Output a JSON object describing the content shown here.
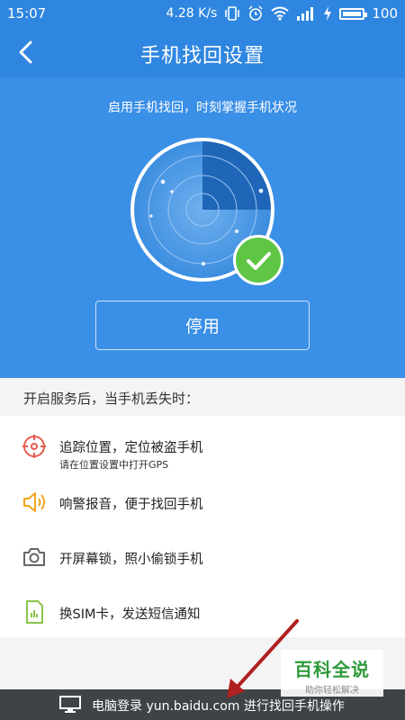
{
  "status_bar": {
    "time": "15:07",
    "speed": "4.28 K/s",
    "battery": "100"
  },
  "header": {
    "title": "手机找回设置"
  },
  "hero": {
    "subtitle": "启用手机找回，时刻掌握手机状况",
    "button_label": "停用",
    "colors": {
      "primary": "#2f86e0",
      "hero_bg": "#3a8fe6",
      "check_green": "#5fc645"
    }
  },
  "features": {
    "header": "开启服务后，当手机丢失时：",
    "items": [
      {
        "icon": "target-icon",
        "label": "追踪位置，定位被盗手机",
        "sublabel": "请在位置设置中打开GPS",
        "color": "#e55b4c"
      },
      {
        "icon": "speaker-icon",
        "label": "响警报音，便于找回手机",
        "color": "#f2a51c"
      },
      {
        "icon": "camera-icon",
        "label": "开屏幕锁，照小偷锁手机",
        "color": "#666666"
      },
      {
        "icon": "sim-card-icon",
        "label": "换SIM卡，发送短信通知",
        "color": "#8bc34a"
      }
    ]
  },
  "bottom": {
    "text": "电脑登录 yun.baidu.com 进行找回手机操作"
  },
  "watermark": {
    "main": "百科全说",
    "sub": "助你轻松解决"
  }
}
